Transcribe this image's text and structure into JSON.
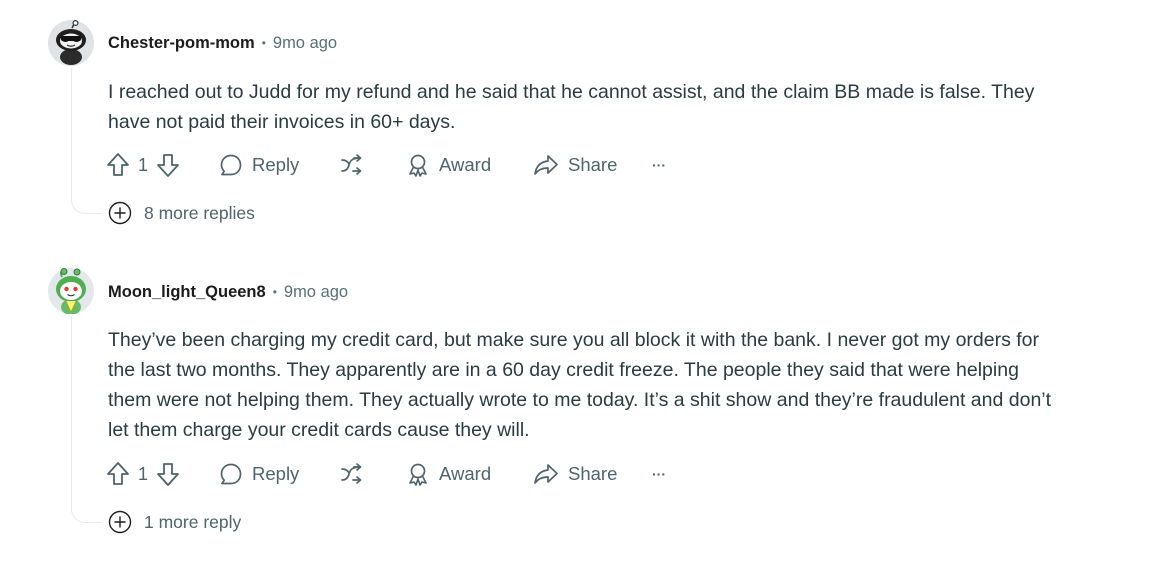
{
  "comments": [
    {
      "username": "Chester-pom-mom",
      "separator": "•",
      "time": "9mo ago",
      "body_lines": [
        "I reached out to Judd for my refund and he said that he cannot assist, and the claim BB made is false. They",
        "have not paid their invoices in 60+ days."
      ],
      "upvotes": "1",
      "reply_label": "Reply",
      "award_label": "Award",
      "share_label": "Share",
      "more_label": "···",
      "more_replies": "8 more replies"
    },
    {
      "username": "Moon_light_Queen8",
      "separator": "•",
      "time": "9mo ago",
      "body_lines": [
        "They’ve been charging my credit card, but make sure you all block it with the bank. I never got my orders for",
        "the last two months. They apparently are in a 60 day credit freeze. The people they said that were helping",
        "them were not helping them. They actually wrote to me today. It’s a shit show and they’re fraudulent and don’t",
        "let them charge your credit cards cause they will."
      ],
      "upvotes": "1",
      "reply_label": "Reply",
      "award_label": "Award",
      "share_label": "Share",
      "more_label": "···",
      "more_replies": "1 more reply"
    }
  ],
  "colors": {
    "text": "#2a3c42",
    "muted": "#576f76",
    "thread": "#e5ebee"
  },
  "icons": {
    "upvote": "upvote-arrow-icon",
    "downvote": "downvote-arrow-icon",
    "reply": "speech-bubble-icon",
    "crosspost": "crosspost-icon",
    "award": "award-ribbon-icon",
    "share": "share-arrow-icon",
    "overflow": "ellipsis-icon",
    "expand": "plus-circle-icon"
  }
}
